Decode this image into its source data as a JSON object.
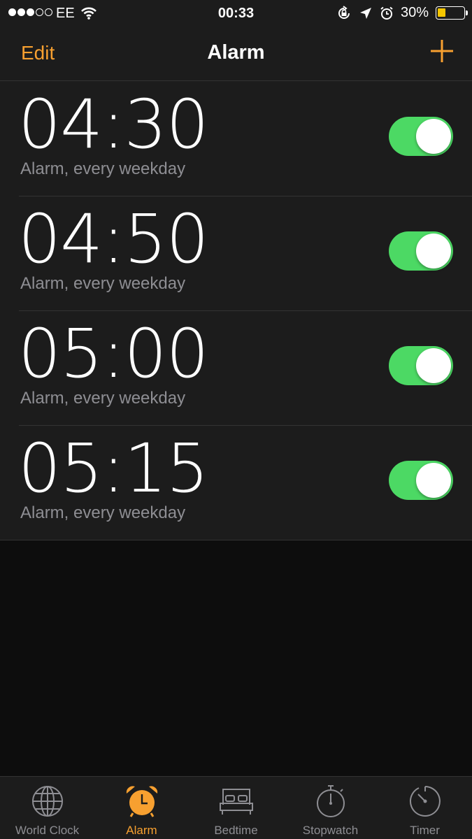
{
  "status_bar": {
    "carrier": "EE",
    "time": "00:33",
    "battery_percent": "30%",
    "battery_level": 0.3,
    "signal_bars_filled": 3,
    "signal_bars_total": 5
  },
  "nav": {
    "edit_label": "Edit",
    "title": "Alarm",
    "add_icon": "plus-icon"
  },
  "alarms": [
    {
      "time": "04:30",
      "label": "Alarm, every weekday",
      "enabled": true
    },
    {
      "time": "04:50",
      "label": "Alarm, every weekday",
      "enabled": true
    },
    {
      "time": "05:00",
      "label": "Alarm, every weekday",
      "enabled": true
    },
    {
      "time": "05:15",
      "label": "Alarm, every weekday",
      "enabled": true
    }
  ],
  "tabs": [
    {
      "label": "World Clock",
      "icon": "globe-icon",
      "active": false
    },
    {
      "label": "Alarm",
      "icon": "alarm-clock-icon",
      "active": true
    },
    {
      "label": "Bedtime",
      "icon": "bed-icon",
      "active": false
    },
    {
      "label": "Stopwatch",
      "icon": "stopwatch-icon",
      "active": false
    },
    {
      "label": "Timer",
      "icon": "timer-icon",
      "active": false
    }
  ],
  "colors": {
    "accent": "#f7a030",
    "toggle_on": "#4cd964",
    "background": "#1c1c1c",
    "secondary_text": "#8e8e93"
  }
}
